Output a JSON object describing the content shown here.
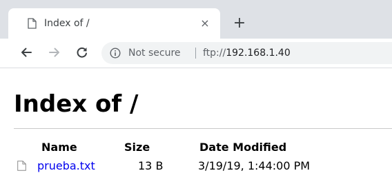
{
  "browser": {
    "tab": {
      "title": "Index of /",
      "close_glyph": "×",
      "favicon": "page-icon"
    },
    "new_tab_glyph": "+",
    "nav": {
      "back": "back-arrow-icon",
      "forward": "forward-arrow-icon",
      "reload": "reload-icon"
    },
    "omnibox": {
      "security_icon": "info-icon",
      "security_label": "Not secure",
      "url_scheme": "ftp://",
      "url_host": "192.168.1.40"
    }
  },
  "page": {
    "title": "Index of /",
    "columns": {
      "name": "Name",
      "size": "Size",
      "date": "Date Modified"
    },
    "rows": [
      {
        "icon": "file-icon",
        "name": "prueba.txt",
        "size": "13 B",
        "date": "3/19/19, 1:44:00 PM"
      }
    ]
  },
  "colors": {
    "tabstrip": "#dee1e6",
    "omnibox": "#f1f3f4",
    "link": "#0000ee"
  }
}
